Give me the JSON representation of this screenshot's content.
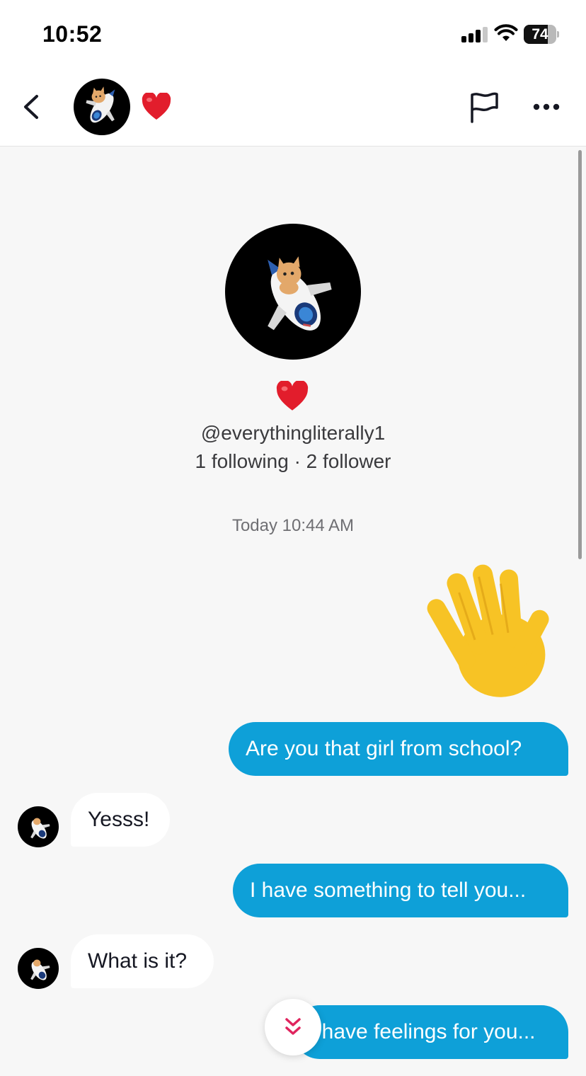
{
  "status_bar": {
    "time": "10:52",
    "battery_level": "74",
    "signal_bars": 3,
    "wifi": true
  },
  "header": {
    "back_icon": "chevron-left-icon",
    "avatar": "kitten-airplane-avatar",
    "name_emoji": "❤️",
    "report_icon": "flag-icon",
    "more_icon": "ellipsis-icon"
  },
  "profile": {
    "avatar": "kitten-airplane-avatar",
    "emoji": "❤️",
    "username": "@everythingliterally1",
    "stats": "1 following · 2 follower"
  },
  "conversation": {
    "timestamp": "Today 10:44 AM",
    "sticker": "waving-hand-emoji",
    "messages": [
      {
        "direction": "out",
        "text": "Are you that girl from school?"
      },
      {
        "direction": "in",
        "text": "Yesss!"
      },
      {
        "direction": "out",
        "text": "I have something to tell you..."
      },
      {
        "direction": "in",
        "text": "What is it?"
      },
      {
        "direction": "out",
        "text": "I have feelings for you..."
      }
    ]
  },
  "scroll_to_bottom": {
    "icon": "double-chevron-down-icon"
  },
  "colors": {
    "outgoing_bubble": "#0ea0d8",
    "incoming_bubble": "#ffffff",
    "background": "#f7f7f7",
    "accent": "#e0245e"
  }
}
